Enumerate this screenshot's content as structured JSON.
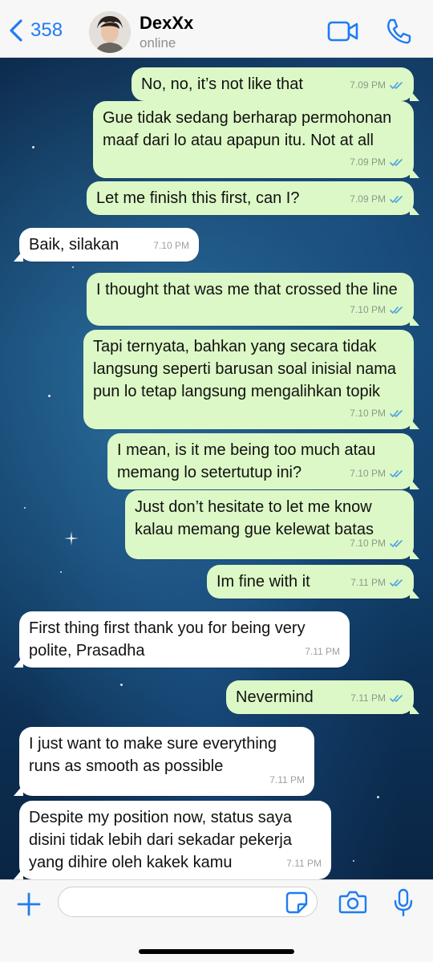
{
  "header": {
    "back_count": "358",
    "contact_name": "DexXx",
    "contact_status": "online"
  },
  "messages": [
    {
      "dir": "out",
      "text": "No, no, it’s not like that",
      "time": "7.09 PM"
    },
    {
      "dir": "out",
      "text": "Gue tidak sedang berharap permohonan maaf dari lo atau apapun itu. Not at all",
      "time": "7.09 PM"
    },
    {
      "dir": "out",
      "text": "Let me finish this first, can I?",
      "time": "7.09 PM"
    },
    {
      "dir": "in",
      "text": "Baik, silakan",
      "time": "7.10 PM"
    },
    {
      "dir": "out",
      "text": "I thought that was me that crossed the line",
      "time": "7.10 PM"
    },
    {
      "dir": "out",
      "text": "Tapi ternyata, bahkan yang secara tidak langsung seperti barusan soal inisial nama pun lo tetap langsung mengalihkan topik",
      "time": "7.10 PM"
    },
    {
      "dir": "out",
      "text": "I mean, is it me being too much atau memang lo setertutup ini?",
      "time": "7.10 PM"
    },
    {
      "dir": "out",
      "text": "Just don’t hesitate to let me know kalau memang gue kelewat batas",
      "time": "7.10 PM"
    },
    {
      "dir": "out",
      "text": "Im fine with it",
      "time": "7.11 PM"
    },
    {
      "dir": "in",
      "text": "First thing first thank you for being very polite, Prasadha",
      "time": "7.11 PM"
    },
    {
      "dir": "out",
      "text": "Nevermind",
      "time": "7.11 PM"
    },
    {
      "dir": "in",
      "text": "I just want to make sure everything runs as smooth as possible",
      "time": "7.11 PM"
    },
    {
      "dir": "in",
      "text": "Despite my position now, status saya disini tidak lebih dari sekadar pekerja yang dihire oleh kakek kamu",
      "time": "7.11 PM"
    }
  ],
  "input": {
    "value": ""
  },
  "colors": {
    "accent": "#1e7cf2",
    "outgoing_bubble": "#dcf8c6",
    "incoming_bubble": "#ffffff",
    "read_ticks": "#4fa3e0"
  }
}
